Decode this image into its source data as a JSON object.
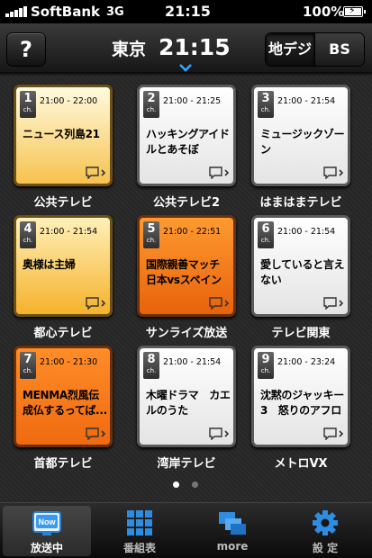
{
  "status_bar": {
    "carrier": "SoftBank",
    "network": "3G",
    "time": "21:15",
    "battery": "100%"
  },
  "nav": {
    "help_label": "?",
    "city": "東京",
    "time": "21:15",
    "segments": [
      "地デジ",
      "BS"
    ],
    "selected_segment": "地デジ"
  },
  "channels": [
    {
      "number": "1",
      "unit": "ch.",
      "time": "21:00 - 22:00",
      "program": "ニュース列島21",
      "name": "公共テレビ",
      "color": "#f9d27a"
    },
    {
      "number": "2",
      "unit": "ch.",
      "time": "21:00 - 21:25",
      "program": "ハッキングアイドルとあそぼ",
      "name": "公共テレビ2",
      "color": "#ffffff"
    },
    {
      "number": "3",
      "unit": "ch.",
      "time": "21:00 - 21:54",
      "program": "ミュージックゾーン",
      "name": "はまはまテレビ",
      "color": "#ffffff"
    },
    {
      "number": "4",
      "unit": "ch.",
      "time": "21:00 - 21:54",
      "program": "奥様は主婦",
      "name": "都心テレビ",
      "color": "#f7bf45"
    },
    {
      "number": "5",
      "unit": "ch.",
      "time": "21:00 - 22:51",
      "program": "国際親善マッチ 日本vsスペイン",
      "name": "サンライズ放送",
      "color": "#f07418"
    },
    {
      "number": "6",
      "unit": "ch.",
      "time": "21:00 - 21:54",
      "program": "愛していると言えない",
      "name": "テレビ関東",
      "color": "#ffffff"
    },
    {
      "number": "7",
      "unit": "ch.",
      "time": "21:00 - 21:30",
      "program": "MENMA烈風伝 成仏するってば...",
      "name": "首都テレビ",
      "color": "#f27a1e"
    },
    {
      "number": "8",
      "unit": "ch.",
      "time": "21:00 - 21:54",
      "program": "木曜ドラマ　カエルのうた",
      "name": "湾岸テレビ",
      "color": "#ffffff"
    },
    {
      "number": "9",
      "unit": "ch.",
      "time": "21:00 - 23:24",
      "program": "沈黙のジャッキー3　怒りのアフロ",
      "name": "メトロVX",
      "color": "#ffffff"
    }
  ],
  "pager": {
    "pages": 2,
    "current": 1
  },
  "tabs": [
    {
      "label": "放送中",
      "icon": "now-tv-icon",
      "badge": "Now",
      "active": true
    },
    {
      "label": "番組表",
      "icon": "program-grid-icon",
      "active": false
    },
    {
      "label": "more",
      "icon": "more-windows-icon",
      "active": false
    },
    {
      "label": "設 定",
      "icon": "gear-icon",
      "active": false
    }
  ]
}
